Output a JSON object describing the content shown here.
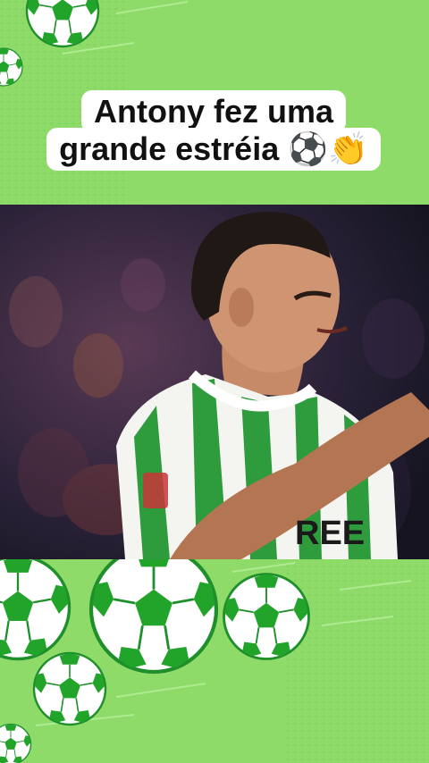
{
  "caption": {
    "line1": "Antony fez uma",
    "line2": "grande estréia ⚽👏"
  },
  "photo": {
    "jersey_text": "REE"
  },
  "colors": {
    "background": "#8edb6a",
    "ball_green": "#22a32a",
    "kit_green": "#2e9b3d"
  }
}
